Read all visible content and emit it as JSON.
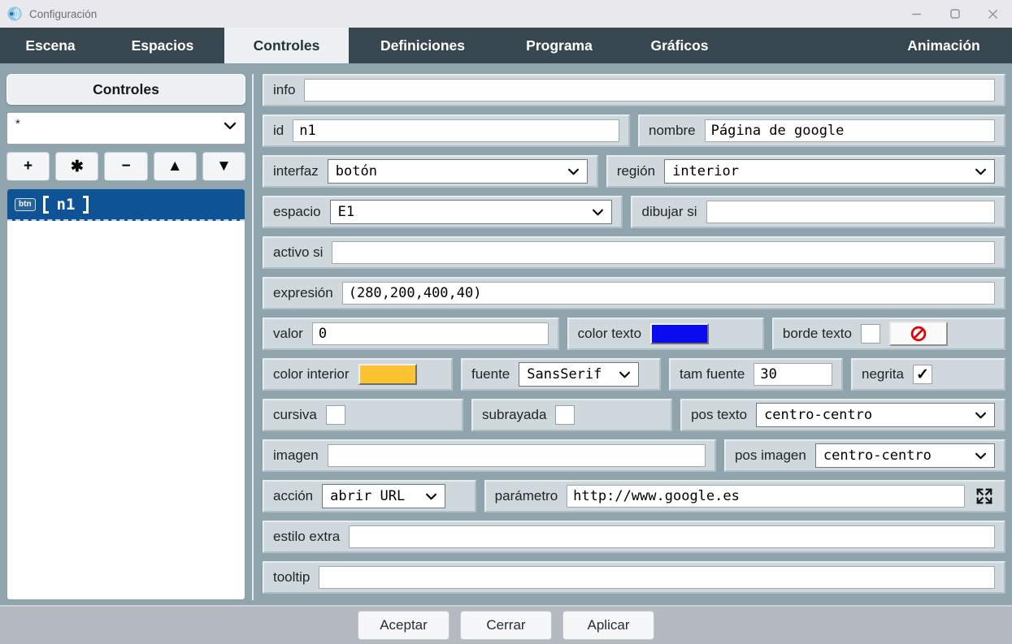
{
  "window": {
    "title": "Configuración"
  },
  "titlebar": {
    "controls": [
      {
        "name": "minimize",
        "glyph": "—"
      },
      {
        "name": "maximize",
        "glyph": ""
      },
      {
        "name": "close",
        "glyph": ""
      }
    ]
  },
  "tabs": [
    {
      "label": "Escena",
      "active": false
    },
    {
      "label": "Espacios",
      "active": false
    },
    {
      "label": "Controles",
      "active": true
    },
    {
      "label": "Definiciones",
      "active": false
    },
    {
      "label": "Programa",
      "active": false
    },
    {
      "label": "Gráficos",
      "active": false
    },
    {
      "label": "Animación",
      "active": false
    }
  ],
  "left_panel": {
    "header": "Controles",
    "filter_select": {
      "value": "*"
    },
    "toolbar": [
      {
        "name": "add",
        "glyph": "+"
      },
      {
        "name": "clone",
        "glyph": "✱"
      },
      {
        "name": "remove",
        "glyph": "−"
      },
      {
        "name": "move-up",
        "glyph": "▲"
      },
      {
        "name": "move-down",
        "glyph": "▼"
      }
    ],
    "list": [
      {
        "badge": "btn",
        "name": "n1",
        "display": "【n1】",
        "selected": true
      }
    ]
  },
  "form": {
    "info": {
      "label": "info",
      "value": ""
    },
    "id": {
      "label": "id",
      "value": "n1"
    },
    "nombre": {
      "label": "nombre",
      "value": "Página de google"
    },
    "interfaz": {
      "label": "interfaz",
      "value": "botón"
    },
    "region": {
      "label": "región",
      "value": "interior"
    },
    "espacio": {
      "label": "espacio",
      "value": "E1"
    },
    "dibujar_si": {
      "label": "dibujar si",
      "value": ""
    },
    "activo_si": {
      "label": "activo si",
      "value": ""
    },
    "expresion": {
      "label": "expresión",
      "value": "(280,200,400,40)"
    },
    "valor": {
      "label": "valor",
      "value": "0"
    },
    "color_texto": {
      "label": "color texto",
      "color": "#0B0BEF",
      "css": "background:#0B0BEF"
    },
    "borde_texto": {
      "label": "borde texto",
      "checked": false,
      "glyph": ""
    },
    "color_interior": {
      "label": "color interior",
      "color": "#FDC330",
      "css": "background:#FDC330"
    },
    "fuente": {
      "label": "fuente",
      "value": "SansSerif"
    },
    "tam_fuente": {
      "label": "tam fuente",
      "value": "30"
    },
    "negrita": {
      "label": "negrita",
      "checked": true,
      "glyph": "✓"
    },
    "cursiva": {
      "label": "cursiva",
      "checked": false,
      "glyph": ""
    },
    "subrayada": {
      "label": "subrayada",
      "checked": false,
      "glyph": ""
    },
    "pos_texto": {
      "label": "pos texto",
      "value": "centro-centro"
    },
    "imagen": {
      "label": "imagen",
      "value": ""
    },
    "pos_imagen": {
      "label": "pos imagen",
      "value": "centro-centro"
    },
    "accion": {
      "label": "acción",
      "value": "abrir URL"
    },
    "parametro": {
      "label": "parámetro",
      "value": "http://www.google.es"
    },
    "estilo_extra": {
      "label": "estilo extra",
      "value": ""
    },
    "tooltip": {
      "label": "tooltip",
      "value": ""
    }
  },
  "footer": {
    "buttons": [
      "Aceptar",
      "Cerrar",
      "Aplicar"
    ]
  },
  "colors": {
    "tab_bar": "#36474F",
    "active_tab_bg": "#ECF0F2",
    "selected_list_item": "#0E5396",
    "row_panel": "#CFD8DC",
    "outer_background": "#90A4AE",
    "text_color_swatch": "#0B0BEF",
    "interior_color_swatch": "#FDC330",
    "block_icon_red": "#E00000"
  }
}
